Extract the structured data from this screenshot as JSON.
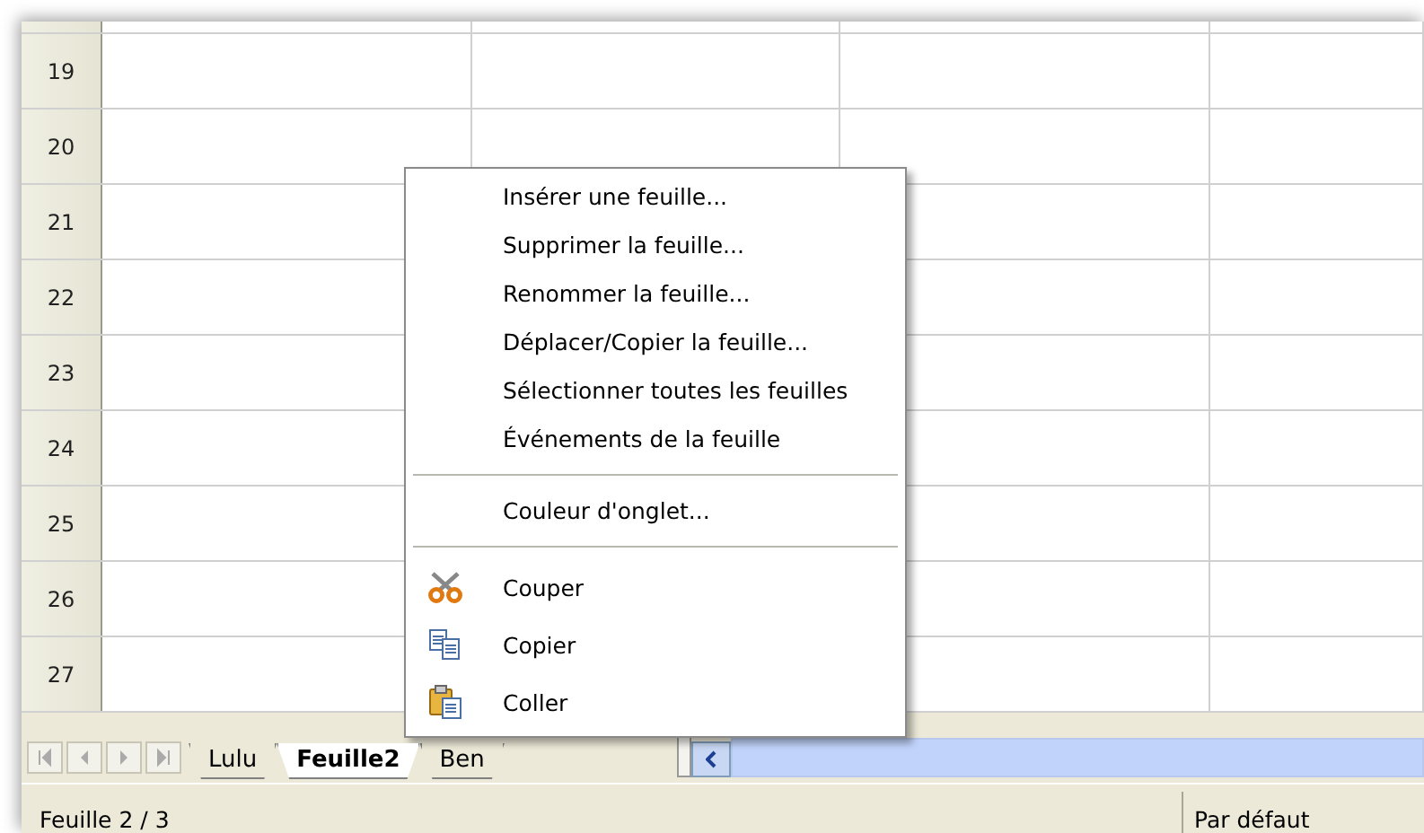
{
  "sheet": {
    "row_headers": [
      "19",
      "20",
      "21",
      "22",
      "23",
      "24",
      "25",
      "26",
      "27"
    ]
  },
  "context_menu": {
    "items": [
      {
        "kind": "text",
        "label": "Insérer une feuille..."
      },
      {
        "kind": "text",
        "label": "Supprimer la feuille..."
      },
      {
        "kind": "text",
        "label": "Renommer la feuille..."
      },
      {
        "kind": "text",
        "label": "Déplacer/Copier la feuille..."
      },
      {
        "kind": "text",
        "label": "Sélectionner toutes les feuilles"
      },
      {
        "kind": "text",
        "label": "Événements de la feuille"
      },
      {
        "kind": "separator"
      },
      {
        "kind": "text",
        "label": "Couleur d'onglet..."
      },
      {
        "kind": "separator"
      },
      {
        "kind": "cut",
        "label": "Couper"
      },
      {
        "kind": "copy",
        "label": "Copier"
      },
      {
        "kind": "paste",
        "label": "Coller"
      }
    ]
  },
  "sheet_tabs": [
    {
      "label": "Lulu",
      "selected": false
    },
    {
      "label": "Feuille2",
      "selected": true
    },
    {
      "label": "Ben",
      "selected": false
    }
  ],
  "status_bar": {
    "sheet_position": "Feuille 2 / 3",
    "page_style": "Par défaut"
  }
}
